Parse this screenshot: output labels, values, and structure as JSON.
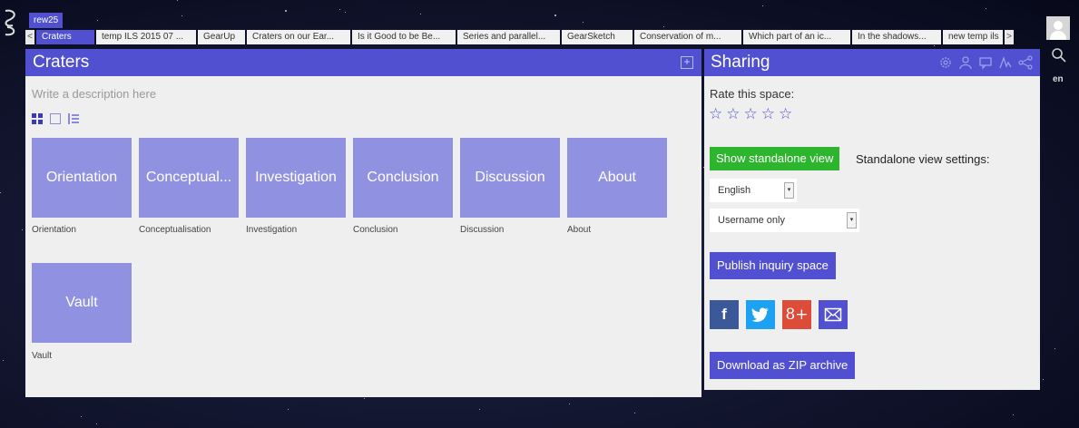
{
  "topbar": {
    "user_tag": "rew25",
    "tabs": [
      {
        "label": "Craters",
        "active": true
      },
      {
        "label": "temp ILS 2015 07 ..."
      },
      {
        "label": "GearUp"
      },
      {
        "label": "Craters on our Ear..."
      },
      {
        "label": "Is it Good to be Be..."
      },
      {
        "label": "Series and parallel..."
      },
      {
        "label": "GearSketch"
      },
      {
        "label": "Conservation of m..."
      },
      {
        "label": "Which part of an ic..."
      },
      {
        "label": "In the shadows..."
      },
      {
        "label": "new temp ils"
      }
    ],
    "prev_arrow": "<",
    "next_arrow": ">",
    "language": "en",
    "icons": {
      "avatar": "user-avatar-icon",
      "search": "search-icon",
      "logo": "app-logo-icon"
    }
  },
  "main": {
    "title": "Craters",
    "expand_icon": "+",
    "description_placeholder": "Write a description here",
    "view_modes": [
      "grid-view-icon",
      "single-view-icon",
      "list-view-icon"
    ],
    "tiles": [
      {
        "label": "Orientation",
        "caption": "Orientation"
      },
      {
        "label": "Conceptual...",
        "caption": "Conceptualisation"
      },
      {
        "label": "Investigation",
        "caption": "Investigation"
      },
      {
        "label": "Conclusion",
        "caption": "Conclusion"
      },
      {
        "label": "Discussion",
        "caption": "Discussion"
      },
      {
        "label": "About",
        "caption": "About"
      },
      {
        "label": "Vault",
        "caption": "Vault"
      }
    ],
    "colors": {
      "header": "#5050d0",
      "tile": "#9191e2",
      "panel": "#efefef"
    }
  },
  "sharing": {
    "title": "Sharing",
    "tool_icons": [
      "settings-icon",
      "members-icon",
      "chat-icon",
      "activity-icon",
      "share-icon"
    ],
    "rate_label": "Rate this space:",
    "stars": [
      "☆",
      "☆",
      "☆",
      "☆",
      "☆"
    ],
    "rating": 0,
    "standalone_button": "Show standalone view",
    "standalone_settings_label": "Standalone view settings:",
    "language_select": "English",
    "identity_select": "Username only",
    "select_arrow": "▾",
    "publish_button": "Publish inquiry space",
    "social": [
      {
        "glyph": "f",
        "icon": "facebook-icon",
        "color": "#3b5998"
      },
      {
        "glyph": "",
        "icon": "twitter-icon",
        "color": "#1da1f2"
      },
      {
        "glyph": "8+",
        "icon": "google-plus-icon",
        "color": "#dd4b39"
      },
      {
        "glyph": "",
        "icon": "email-icon",
        "color": "#5050d0"
      }
    ],
    "download_button": "Download as ZIP archive",
    "colors": {
      "green": "#2db52d",
      "blue": "#5050d0"
    }
  }
}
